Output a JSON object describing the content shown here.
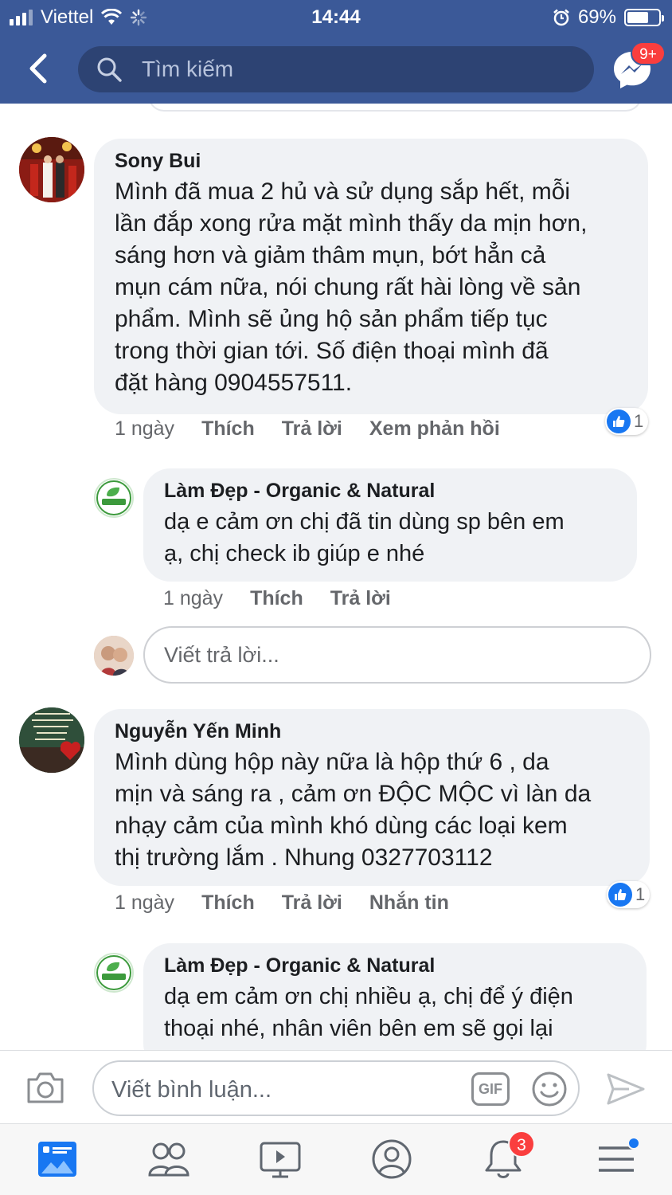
{
  "status_bar": {
    "carrier": "Viettel",
    "time": "14:44",
    "battery_percent": "69%",
    "battery_level": 0.69
  },
  "header": {
    "search_placeholder": "Tìm kiếm",
    "messenger_badge": "9+"
  },
  "comments": [
    {
      "author": "Sony Bui",
      "text": "Mình đã mua 2 hủ và sử dụng sắp hết, mỗi\nlần đắp xong rửa mặt mình thấy da mịn hơn,\nsáng hơn và giảm thâm mụn, bớt hẳn cả\nmụn cám nữa, nói chung rất hài lòng về sản\nphẩm. Mình sẽ ủng hộ sản phẩm tiếp tục\ntrong thời gian tới. Số điện thoại mình đã\nđặt hàng 0904557511.",
      "time": "1 ngày",
      "like_label": "Thích",
      "reply_label": "Trả lời",
      "extra_label": "Xem phản hồi",
      "reaction_count": "1",
      "reply": {
        "author": "Làm Đẹp - Organic & Natural",
        "text": "dạ e cảm ơn chị đã tin dùng sp bên em\nạ, chị check ib giúp e nhé",
        "time": "1 ngày",
        "like_label": "Thích",
        "reply_label": "Trả lời"
      },
      "reply_placeholder": "Viết trả lời..."
    },
    {
      "author": "Nguyễn Yến Minh",
      "text": "Mình dùng hộp này nữa là hộp thứ 6 , da\nmịn và sáng ra , cảm ơn ĐỘC MỘC  vì làn da\nnhạy cảm của mình khó dùng các loại kem\nthị trường lắm . Nhung 0327703112",
      "time": "1 ngày",
      "like_label": "Thích",
      "reply_label": "Trả lời",
      "extra_label": "Nhắn tin",
      "reaction_count": "1",
      "reply": {
        "author": "Làm Đẹp - Organic & Natural",
        "text": "dạ em cảm ơn chị nhiều ạ, chị để ý điện\nthoại nhé, nhân viên bên em sẽ gọi lại"
      }
    }
  ],
  "composer": {
    "placeholder": "Viết bình luận...",
    "gif_label": "GIF"
  },
  "tabbar": {
    "notifications_badge": "3"
  },
  "colors": {
    "brand": "#3b5998",
    "like_blue": "#1877f2",
    "badge_red": "#fa3e3e",
    "bubble_gray": "#f0f2f5"
  }
}
